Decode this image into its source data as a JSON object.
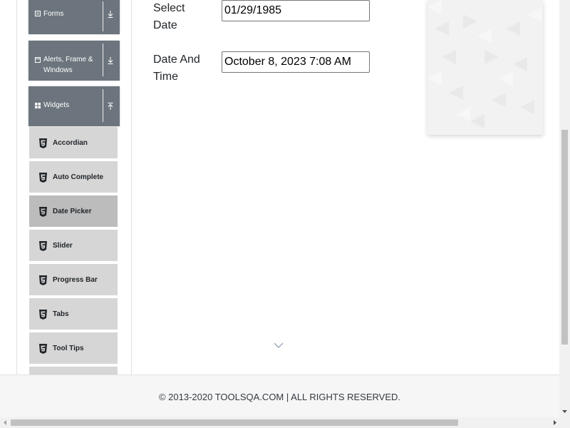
{
  "sidebar": {
    "groups": [
      {
        "label": "Forms",
        "icon": "form-icon",
        "arrow": "download-arrow-icon"
      },
      {
        "label": "Alerts, Frame & Windows",
        "icon": "window-icon",
        "arrow": "download-arrow-icon"
      },
      {
        "label": "Widgets",
        "icon": "widgets-icon",
        "arrow": "upload-arrow-icon"
      }
    ],
    "items": [
      {
        "label": "Accordian",
        "active": false
      },
      {
        "label": "Auto Complete",
        "active": false
      },
      {
        "label": "Date Picker",
        "active": true
      },
      {
        "label": "Slider",
        "active": false
      },
      {
        "label": "Progress Bar",
        "active": false
      },
      {
        "label": "Tabs",
        "active": false
      },
      {
        "label": "Tool Tips",
        "active": false
      }
    ],
    "item_icon": "html5-icon"
  },
  "form": {
    "select_date": {
      "label": "Select Date",
      "value": "01/29/1985"
    },
    "date_time": {
      "label": "Date And Time",
      "value": "October 8, 2023 7:08 AM"
    }
  },
  "footer": {
    "text": "© 2013-2020 TOOLSQA.COM | ALL RIGHTS RESERVED."
  },
  "colors": {
    "group_bg": "#6c757d",
    "item_bg": "#d6d6d6",
    "item_active_bg": "#bcbcbc",
    "footer_bg": "#f6f6f6"
  }
}
